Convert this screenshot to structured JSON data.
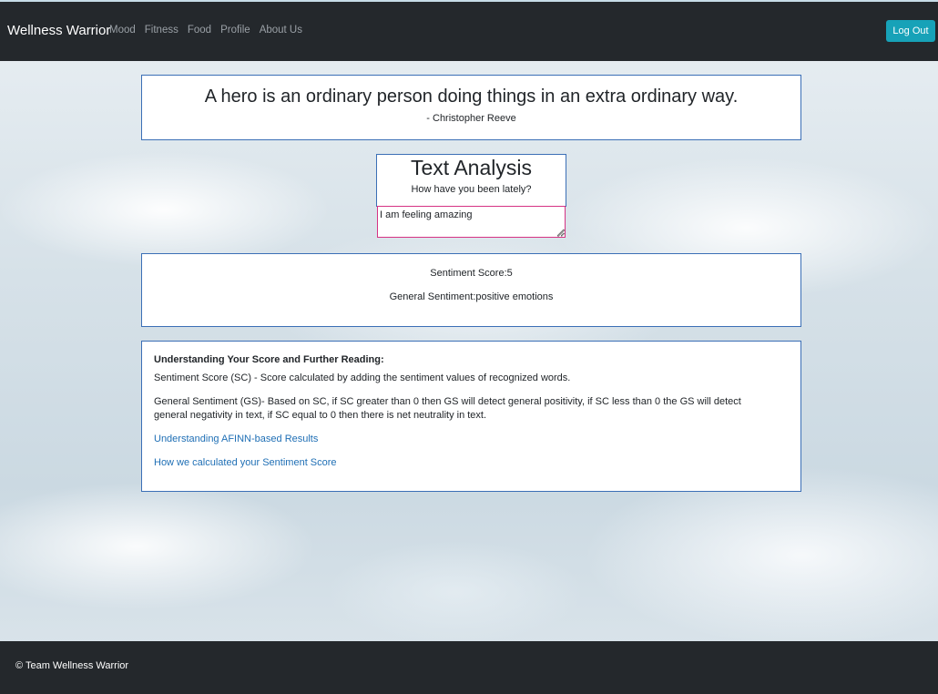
{
  "nav": {
    "brand": "Wellness Warrior",
    "links": [
      "Mood",
      "Fitness",
      "Food",
      "Profile",
      "About Us"
    ],
    "logout_label": "Log Out"
  },
  "quote": {
    "text": "A hero is an ordinary person doing things in an extra ordinary way.",
    "author": "- Christopher Reeve"
  },
  "analysis": {
    "title": "Text Analysis",
    "prompt": "How have you been lately?",
    "input_value": "I am feeling amazing"
  },
  "result": {
    "score_text": "Sentiment Score:5",
    "sentiment_text": "General Sentiment:positive emotions"
  },
  "info": {
    "title": "Understanding Your Score and Further Reading:",
    "sc_text": "Sentiment Score (SC) - Score calculated by adding the sentiment values of recognized words.",
    "gs_text": "General Sentiment (GS)- Based on SC, if SC greater than 0 then GS will detect general positivity, if SC less than 0 the GS will detect general negativity in text, if SC equal to 0 then there is net neutrality in text.",
    "link1": "Understanding AFINN-based Results",
    "link2": "How we calculated your Sentiment Score"
  },
  "footer": {
    "text": "© Team Wellness Warrior"
  },
  "colors": {
    "navbar": "#24282c",
    "accent_button": "#17a2b8",
    "link": "#1f6fb5",
    "box_border": "#3b6fb6",
    "input_border": "#d63384"
  }
}
